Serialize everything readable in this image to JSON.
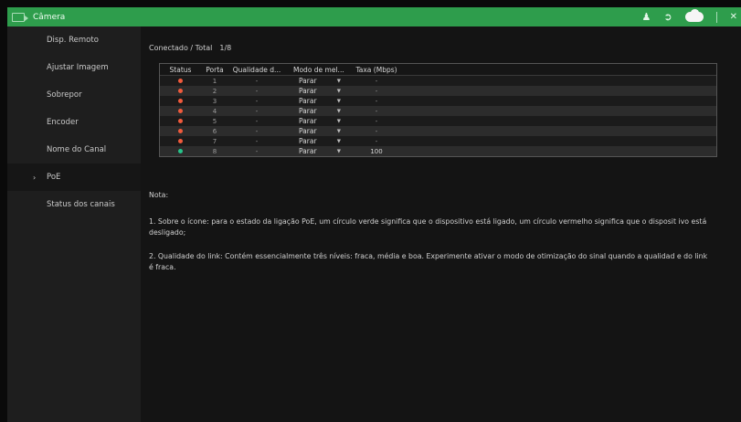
{
  "titlebar": {
    "title": "Câmera",
    "icons": [
      "camera-icon",
      "user-settings-icon",
      "exit-icon",
      "cloud-icon",
      "close-icon"
    ],
    "accent_color": "#2e9d4c"
  },
  "sidebar": {
    "items": [
      {
        "label": "Disp. Remoto"
      },
      {
        "label": "Ajustar Imagem"
      },
      {
        "label": "Sobrepor"
      },
      {
        "label": "Encoder"
      },
      {
        "label": "Nome do Canal"
      },
      {
        "label": "PoE",
        "active": true
      },
      {
        "label": "Status dos canais"
      }
    ]
  },
  "main": {
    "connected_label": "Conectado / Total",
    "connected_value": "1/8",
    "table": {
      "headers": {
        "status": "Status",
        "porta": "Porta",
        "qualidade": "Qualidade d...",
        "modo": "Modo de mel...",
        "taxa": "Taxa (Mbps)"
      },
      "rows": [
        {
          "status": "red",
          "porta": "1",
          "qualidade": "-",
          "modo": "Parar",
          "taxa": "-"
        },
        {
          "status": "red",
          "porta": "2",
          "qualidade": "-",
          "modo": "Parar",
          "taxa": "-"
        },
        {
          "status": "red",
          "porta": "3",
          "qualidade": "-",
          "modo": "Parar",
          "taxa": "-"
        },
        {
          "status": "red",
          "porta": "4",
          "qualidade": "-",
          "modo": "Parar",
          "taxa": "-"
        },
        {
          "status": "red",
          "porta": "5",
          "qualidade": "-",
          "modo": "Parar",
          "taxa": "-"
        },
        {
          "status": "red",
          "porta": "6",
          "qualidade": "-",
          "modo": "Parar",
          "taxa": "-"
        },
        {
          "status": "red",
          "porta": "7",
          "qualidade": "-",
          "modo": "Parar",
          "taxa": "-"
        },
        {
          "status": "green",
          "porta": "8",
          "qualidade": "-",
          "modo": "Parar",
          "taxa": "100"
        }
      ],
      "status_colors": {
        "red": "#f05a3c",
        "green": "#27c48a"
      }
    },
    "nota_label": "Nota:",
    "note_1": "1. Sobre o ícone: para o estado da ligação PoE, um círculo verde significa que o dispositivo está ligado, um círculo vermelho significa que o disposit ivo está desligado;",
    "note_2": "2. Qualidade do link: Contém essencialmente três níveis: fraca, média e boa. Experimente ativar o modo de otimização do sinal quando a qualidad e do link é fraca."
  }
}
